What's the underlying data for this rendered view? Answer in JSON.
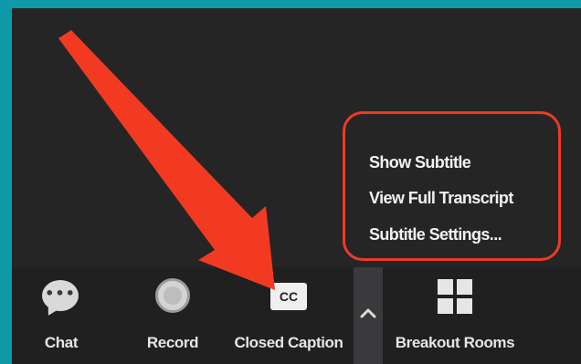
{
  "toolbar": {
    "chat_label": "Chat",
    "record_label": "Record",
    "cc_label": "Closed Caption",
    "cc_icon_text": "CC",
    "breakout_label": "Breakout Rooms"
  },
  "caption_menu": {
    "items": [
      {
        "label": "Show Subtitle"
      },
      {
        "label": "View Full Transcript"
      },
      {
        "label": "Subtitle Settings..."
      }
    ]
  },
  "icons": {
    "chat": "chat-bubble-icon",
    "record": "record-icon",
    "cc": "closed-caption-icon",
    "caret": "chevron-up-icon",
    "breakout": "breakout-rooms-grid-icon"
  },
  "colors": {
    "page_border": "#0e9aa8",
    "window_bg": "#252526",
    "toolbar_bg": "#202021",
    "highlight": "#ee3a26",
    "arrow": "#f23a22"
  }
}
